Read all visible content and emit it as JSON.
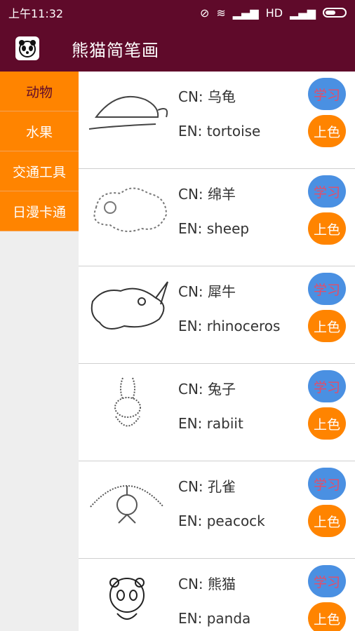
{
  "status": {
    "time": "上午11:32",
    "network": "HD"
  },
  "app_bar": {
    "title": "熊猫简笔画",
    "logo_icon": "panda-icon"
  },
  "sidebar": {
    "categories": [
      {
        "label": "动物"
      },
      {
        "label": "水果"
      },
      {
        "label": "交通工具"
      },
      {
        "label": "日漫卡通"
      }
    ]
  },
  "list": {
    "items": [
      {
        "cn": "CN: 乌龟",
        "en": "EN: tortoise",
        "learn": "学习",
        "color": "上色",
        "icon": "tortoise-icon"
      },
      {
        "cn": "CN: 绵羊",
        "en": "EN: sheep",
        "learn": "学习",
        "color": "上色",
        "icon": "sheep-icon"
      },
      {
        "cn": "CN: 犀牛",
        "en": "EN: rhinoceros",
        "learn": "学习",
        "color": "上色",
        "icon": "rhino-icon"
      },
      {
        "cn": "CN: 兔子",
        "en": "EN: rabiit",
        "learn": "学习",
        "color": "上色",
        "icon": "rabbit-icon"
      },
      {
        "cn": "CN: 孔雀",
        "en": "EN: peacock",
        "learn": "学习",
        "color": "上色",
        "icon": "peacock-icon"
      },
      {
        "cn": "CN: 熊猫",
        "en": "EN: panda",
        "learn": "学习",
        "color": "上色",
        "icon": "panda-icon"
      }
    ]
  },
  "colors": {
    "primary": "#5f0a2a",
    "sidebar": "#ff8400",
    "learn_button": "#4a90e2",
    "color_button": "#ff8400"
  }
}
